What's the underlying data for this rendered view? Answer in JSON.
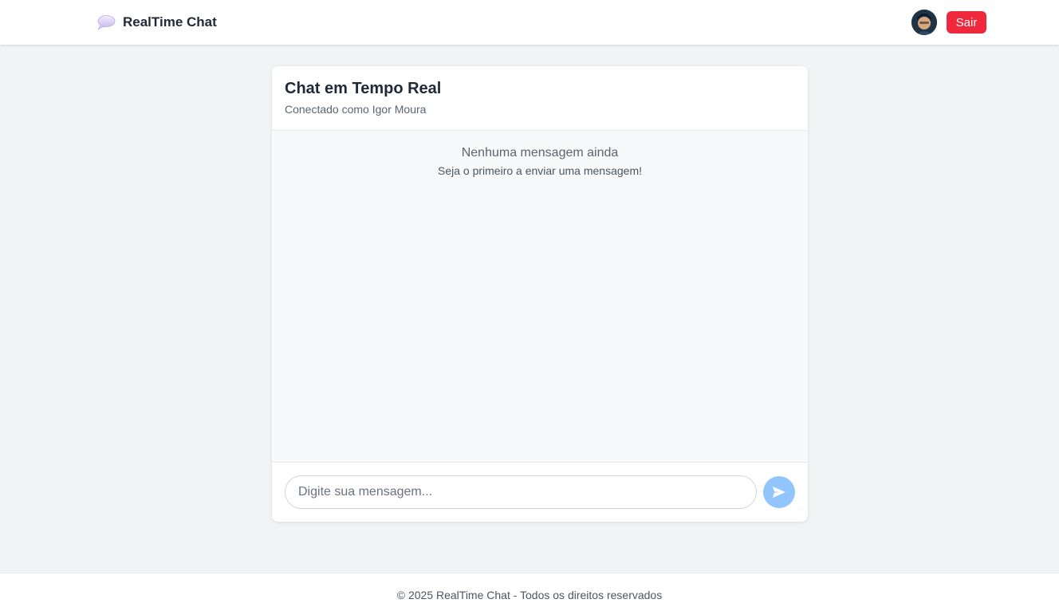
{
  "header": {
    "brand_icon": "speech-bubble-icon",
    "brand_name": "RealTime Chat",
    "logout_label": "Sair"
  },
  "chat": {
    "title": "Chat em Tempo Real",
    "subtitle": "Conectado como Igor Moura",
    "empty_title": "Nenhuma mensagem ainda",
    "empty_subtitle": "Seja o primeiro a enviar uma mensagem!",
    "input_placeholder": "Digite sua mensagem...",
    "input_value": "",
    "send_icon": "send-icon"
  },
  "footer": {
    "text": "© 2025 RealTime Chat - Todos os direitos reservados"
  },
  "colors": {
    "logout": "#f0283c",
    "send_button": "#93c5fd",
    "background": "#f2f3f5"
  }
}
